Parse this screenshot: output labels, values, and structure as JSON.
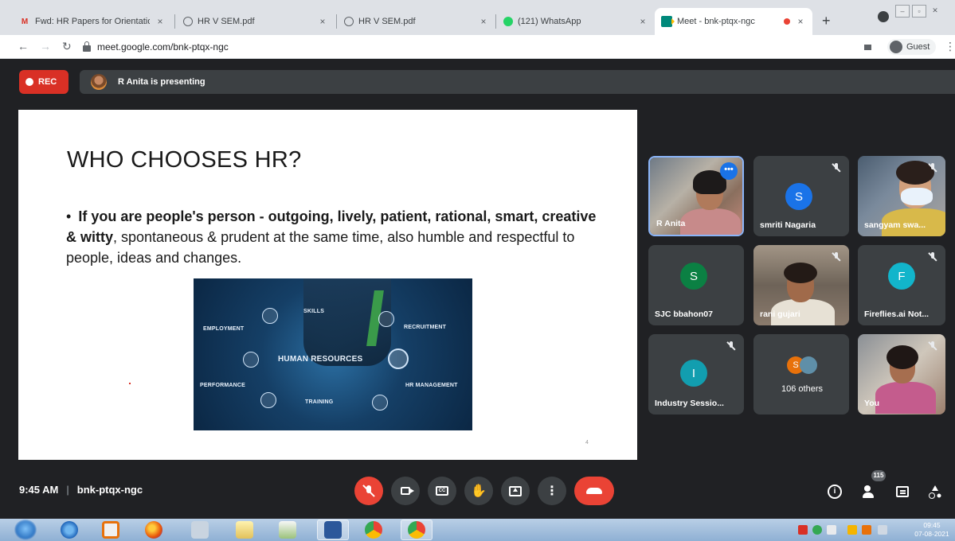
{
  "browser": {
    "tabs": [
      {
        "title": "Fwd: HR Papers for Orientation",
        "icon": "gmail-icon"
      },
      {
        "title": "HR V SEM.pdf",
        "icon": "globe-icon"
      },
      {
        "title": "HR V SEM.pdf",
        "icon": "globe-icon"
      },
      {
        "title": "(121) WhatsApp",
        "icon": "whatsapp-icon"
      },
      {
        "title": "Meet - bnk-ptqx-ngc",
        "icon": "google-meet-icon",
        "active": true,
        "recording": true
      }
    ],
    "new_tab": "+",
    "close_glyph": "×",
    "url": "meet.google.com/bnk-ptqx-ngc",
    "profile_label": "Guest",
    "kebab": "⋮"
  },
  "meet": {
    "rec_label": "REC",
    "presenting_text": "R Anita is presenting",
    "slide": {
      "title": "WHO CHOOSES HR?",
      "bullet": "•",
      "body_bold": "If you are people's person - outgoing, lively,  patient, rational, smart, creative & witty",
      "body_rest": ", spontaneous & prudent at the same time, also humble and respectful to people, ideas and changes.",
      "image_labels": {
        "main": "HUMAN RESOURCES",
        "skills": "SKILLS",
        "employment": "EMPLOYMENT",
        "recruitment": "RECRUITMENT",
        "performance": "PERFORMANCE",
        "training": "TRAINING",
        "hr_management": "HR MANAGEMENT"
      },
      "page_number": "4"
    },
    "participants": [
      {
        "name": "R Anita",
        "type": "video",
        "active": true
      },
      {
        "name": "smriti Nagaria",
        "initial": "S",
        "color": "#1a73e8",
        "muted": true
      },
      {
        "name": "sangyam swa...",
        "type": "video",
        "muted": true
      },
      {
        "name": "SJC bbahon07",
        "initial": "S",
        "color": "#0b8043"
      },
      {
        "name": "rani gujari",
        "type": "video",
        "muted": true
      },
      {
        "name": "Fireflies.ai Not...",
        "initial": "F",
        "color": "#12b5cb",
        "muted": true
      },
      {
        "name": "Industry Sessio...",
        "initial": "I",
        "color": "#129eaf",
        "muted": true
      },
      {
        "name": "106 others",
        "others_initial": "S"
      },
      {
        "name": "You",
        "type": "video",
        "muted": true
      }
    ],
    "time": "9:45 AM",
    "separator": "|",
    "meeting_code": "bnk-ptqx-ngc",
    "people_count": "115",
    "colors": {
      "accent": "#1a73e8",
      "danger": "#ea4335",
      "background": "#202124",
      "tile": "#3c4043"
    }
  },
  "taskbar": {
    "time": "09:45",
    "date": "07-08-2021"
  }
}
